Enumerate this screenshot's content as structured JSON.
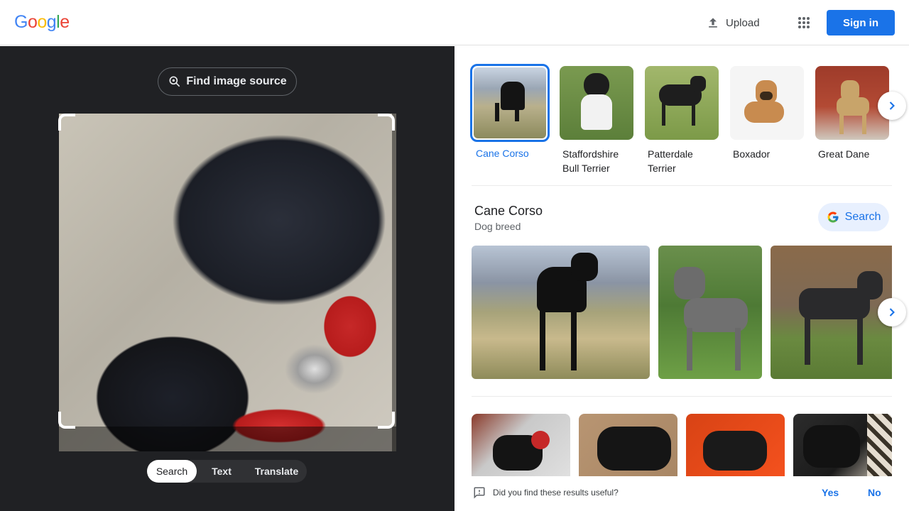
{
  "header": {
    "logo_letters": [
      {
        "ch": "G",
        "color": "#4285F4"
      },
      {
        "ch": "o",
        "color": "#EA4335"
      },
      {
        "ch": "o",
        "color": "#FBBC05"
      },
      {
        "ch": "g",
        "color": "#4285F4"
      },
      {
        "ch": "l",
        "color": "#34A853"
      },
      {
        "ch": "e",
        "color": "#EA4335"
      }
    ],
    "upload_label": "Upload",
    "apps_icon": "apps-grid-icon",
    "signin_label": "Sign in",
    "accent": "#1a73e8"
  },
  "lens": {
    "find_source_label": "Find image source",
    "tabs": [
      {
        "label": "Search",
        "active": true
      },
      {
        "label": "Text",
        "active": false
      },
      {
        "label": "Translate",
        "active": false
      }
    ]
  },
  "breeds": [
    {
      "label": "Cane Corso",
      "selected": true
    },
    {
      "label": "Staffordshire Bull Terrier",
      "selected": false
    },
    {
      "label": "Patterdale Terrier",
      "selected": false
    },
    {
      "label": "Boxador",
      "selected": false
    },
    {
      "label": "Great Dane",
      "selected": false
    }
  ],
  "knowledge": {
    "title": "Cane Corso",
    "subtitle": "Dog breed",
    "search_label": "Search"
  },
  "feedback": {
    "question": "Did you find these results useful?",
    "yes": "Yes",
    "no": "No"
  }
}
